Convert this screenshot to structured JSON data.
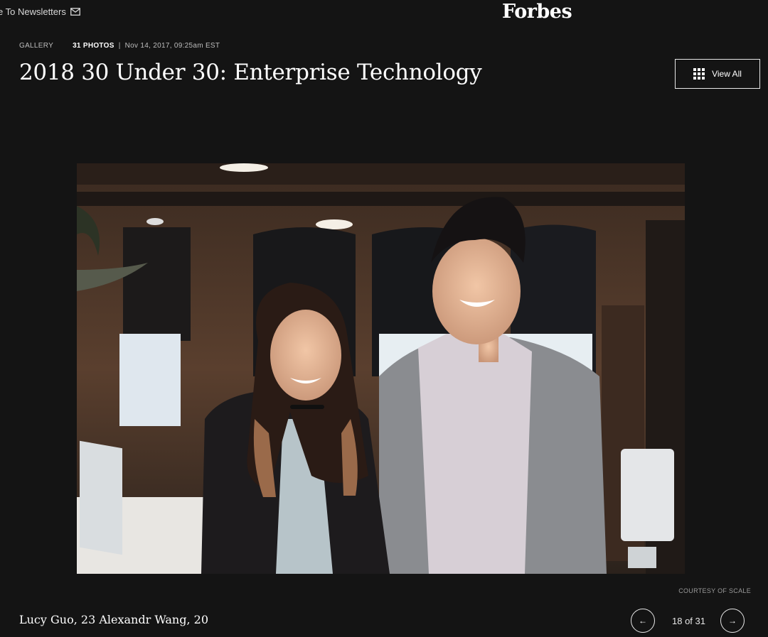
{
  "header": {
    "newsletter_label": "e To Newsletters",
    "newsletter_icon": "mail-icon",
    "logo_text": "Forbes"
  },
  "gallery": {
    "type_label": "GALLERY",
    "photo_count": "31 PHOTOS",
    "separator": "|",
    "date": "Nov 14, 2017, 09:25am EST",
    "title": "2018 30 Under 30: Enterprise Technology",
    "view_all_label": "View All",
    "view_all_icon": "grid-icon"
  },
  "slide": {
    "photo_description_icon": "photo",
    "credit": "COURTESY OF SCALE",
    "caption": "Lucy Guo, 23 Alexandr Wang, 20",
    "position": "18 of 31",
    "prev_icon": "arrow-left-icon",
    "next_icon": "arrow-right-icon"
  },
  "colors": {
    "background": "#141414",
    "text": "#ffffff",
    "muted": "#bdbdbd"
  }
}
